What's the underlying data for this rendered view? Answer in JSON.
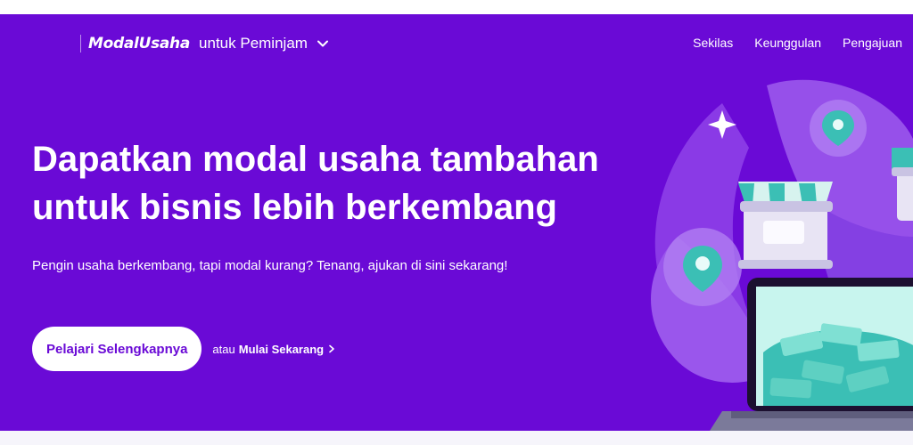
{
  "header": {
    "brand": "ModalUsaha",
    "audience_label": "untuk Peminjam",
    "nav": [
      "Sekilas",
      "Keunggulan",
      "Pengajuan"
    ]
  },
  "hero": {
    "headline_line1": "Dapatkan modal usaha tambahan",
    "headline_line2": "untuk bisnis lebih berkembang",
    "subtitle": "Pengin usaha berkembang, tapi modal kurang? Tenang, ajukan di sini sekarang!",
    "cta_primary": "Pelajari Selengkapnya",
    "cta_or": "atau",
    "cta_secondary": "Mulai Sekarang"
  },
  "colors": {
    "hero_bg": "#6a0ad6",
    "accent_teal": "#3bbfb5",
    "text": "#ffffff"
  },
  "icons": [
    "chevron-down-icon",
    "chevron-right-icon",
    "sparkle-icon",
    "location-pin-icon",
    "store-icon",
    "laptop-icon",
    "money-stack-icon"
  ]
}
